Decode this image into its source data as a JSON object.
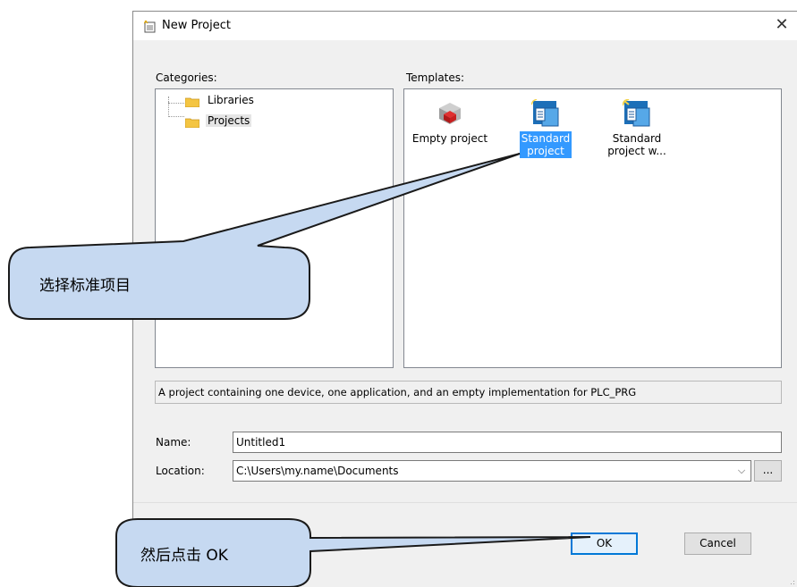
{
  "dialog": {
    "title": "New Project",
    "close_label": "✕",
    "categories_label": "Categories:",
    "templates_label": "Templates:",
    "categories": [
      {
        "label": "Libraries"
      },
      {
        "label": "Projects"
      }
    ],
    "templates": [
      {
        "label_line1": "Empty project",
        "label_line2": ""
      },
      {
        "label_line1": "Standard",
        "label_line2": "project",
        "selected": true
      },
      {
        "label_line1": "Standard",
        "label_line2": "project w..."
      }
    ],
    "description": "A project containing one device, one application, and an empty implementation for PLC_PRG",
    "name_label": "Name:",
    "name_value": "Untitled1",
    "location_label": "Location:",
    "location_value": "C:\\Users\\my.name\\Documents",
    "browse_label": "...",
    "ok_label": "OK",
    "cancel_label": "Cancel"
  },
  "callouts": {
    "callout1": "选择标准项目",
    "callout2": "然后点击 OK"
  },
  "colors": {
    "callout_fill": "#c6d9f1",
    "selection": "#3399ff",
    "ok_border": "#0078d7"
  }
}
